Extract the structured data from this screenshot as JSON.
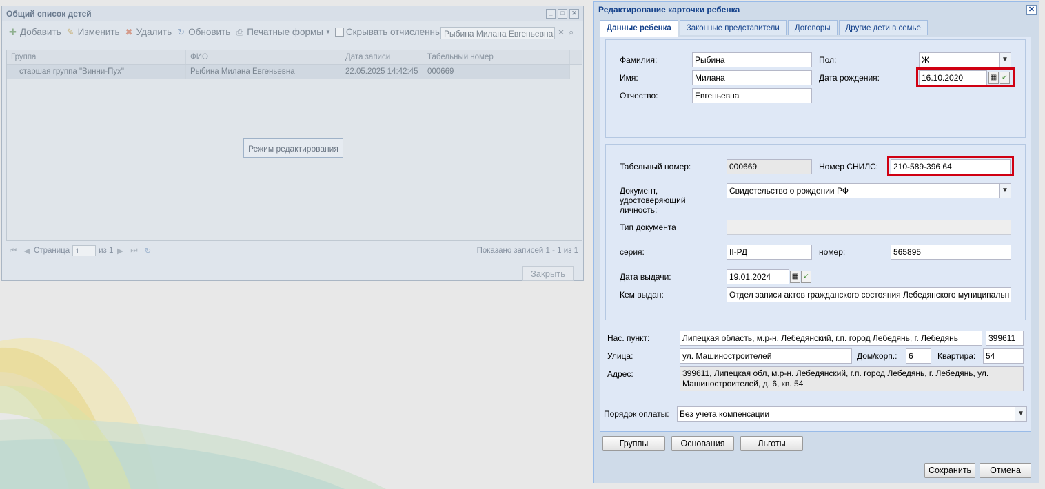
{
  "back_window": {
    "title": "Общий список детей",
    "toolbar": {
      "add": "Добавить",
      "edit": "Изменить",
      "delete": "Удалить",
      "refresh": "Обновить",
      "print": "Печатные формы",
      "hide_expelled": "Скрывать отчисленных"
    },
    "search_value": "Рыбина Милана Евгеньевна",
    "columns": [
      "Группа",
      "ФИО",
      "Дата записи",
      "Табельный номер"
    ],
    "rows": [
      [
        "старшая группа \"Винни-Пух\"",
        "Рыбина Милана Евгеньевна",
        "22.05.2025 14:42:45",
        "000669"
      ]
    ],
    "edit_mode_button": "Режим редактирования",
    "pager": {
      "page_label": "Страница",
      "page_value": "1",
      "of_label": "из 1",
      "shown": "Показано записей 1 - 1 из 1"
    },
    "close_button": "Закрыть"
  },
  "dialog": {
    "title": "Редактирование карточки ребенка",
    "tabs": [
      "Данные ребенка",
      "Законные представители",
      "Договоры",
      "Другие дети в семье"
    ],
    "labels": {
      "surname": "Фамилия:",
      "name": "Имя:",
      "patronymic": "Отчество:",
      "sex": "Пол:",
      "birth_date": "Дата рождения:",
      "tab_number": "Табельный номер:",
      "snils": "Номер СНИЛС:",
      "id_doc_1": "Документ,",
      "id_doc_2": "удостоверяющий",
      "id_doc_3": "личность:",
      "doc_type": "Тип документа",
      "series": "серия:",
      "number": "номер:",
      "issue_date": "Дата выдачи:",
      "issued_by": "Кем выдан:",
      "locality": "Нас. пункт:",
      "street": "Улица:",
      "house": "Дом/корп.:",
      "apartment": "Квартира:",
      "address": "Адрес:",
      "payment": "Порядок оплаты:"
    },
    "values": {
      "surname": "Рыбина",
      "name": "Милана",
      "patronymic": "Евгеньевна",
      "sex": "Ж",
      "birth_date": "16.10.2020",
      "tab_number": "000669",
      "snils": "210-589-396 64",
      "id_doc": "Свидетельство о рождении РФ",
      "doc_type": "",
      "series": "II-РД",
      "number": "565895",
      "issue_date": "19.01.2024",
      "issued_by": "Отдел записи актов гражданского состояния Лебедянского муниципальн",
      "locality": "Липецкая область, м.р-н. Лебедянский, г.п. город Лебедянь, г. Лебедянь",
      "postcode": "399611",
      "street": "ул. Машиностроителей",
      "house": "6",
      "apartment": "54",
      "address_line1": "399611, Липецкая обл, м.р-н. Лебедянский, г.п. город Лебедянь, г. Лебедянь, ул.",
      "address_line2": "Машиностроителей, д. 6, кв. 54",
      "payment": "Без учета компенсации"
    },
    "bottom_buttons": [
      "Группы",
      "Основания",
      "Льготы"
    ],
    "save_button": "Сохранить",
    "cancel_button": "Отмена"
  },
  "colors": {
    "dialog_title": "#15428b",
    "highlight": "#d00012"
  }
}
